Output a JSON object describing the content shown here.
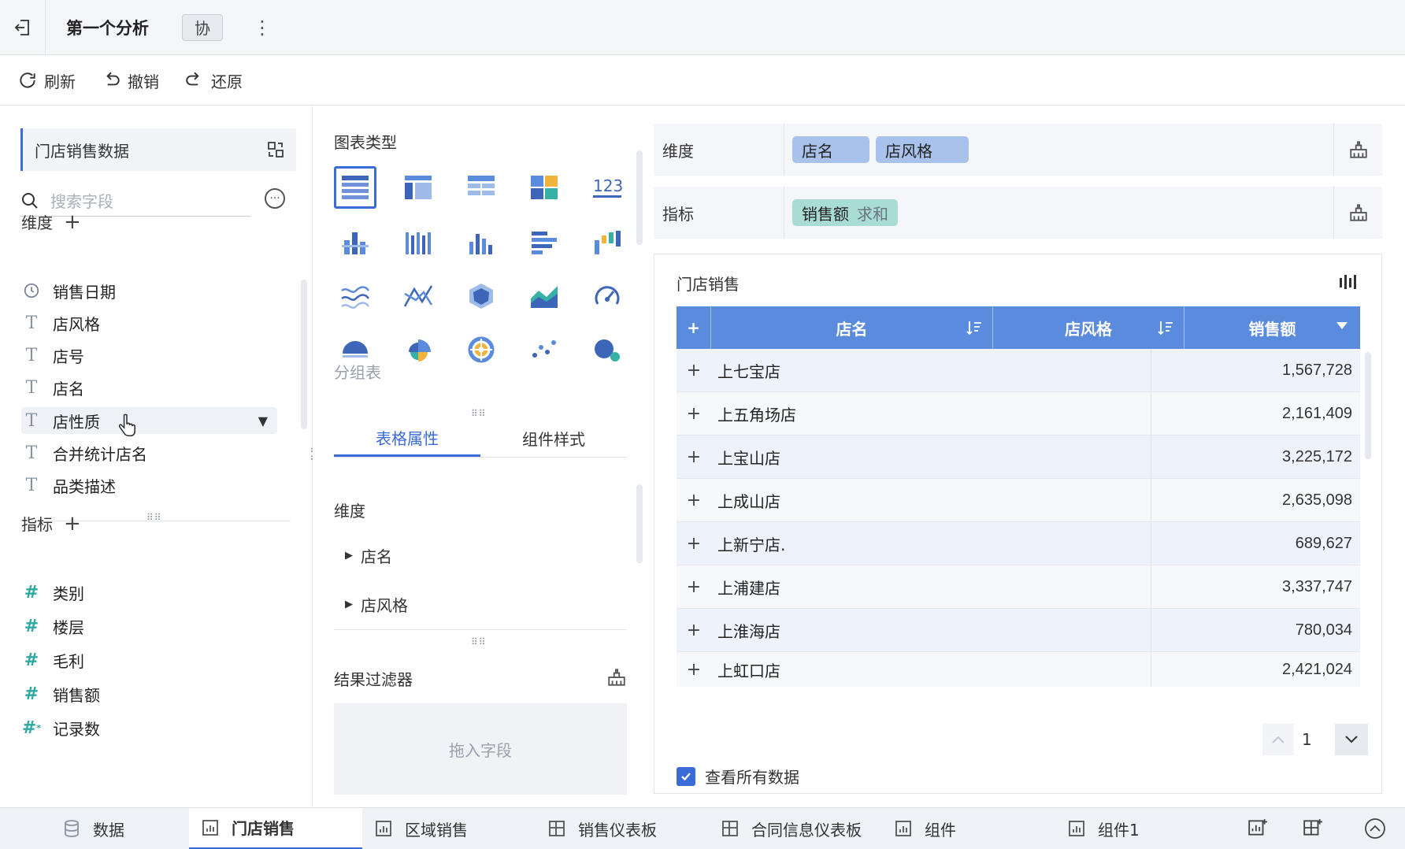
{
  "header": {
    "title": "第一个分析",
    "collab_label": "协",
    "more_label": "⋮"
  },
  "toolbar": {
    "refresh": "刷新",
    "undo": "撤销",
    "redo": "还原"
  },
  "left": {
    "dataset": "门店销售数据",
    "search_placeholder": "搜索字段",
    "dimensions_label": "维度",
    "dimensions": [
      {
        "label": "销售日期",
        "icon": "clock-icon"
      },
      {
        "label": "店风格",
        "icon": "text-type-icon"
      },
      {
        "label": "店号",
        "icon": "text-type-icon"
      },
      {
        "label": "店名",
        "icon": "text-type-icon"
      },
      {
        "label": "店性质",
        "icon": "text-type-icon"
      },
      {
        "label": "合并统计店名",
        "icon": "text-type-icon"
      },
      {
        "label": "品类描述",
        "icon": "text-type-icon"
      }
    ],
    "measures_label": "指标",
    "measures": [
      {
        "label": "类别",
        "icon": "number-type-icon"
      },
      {
        "label": "楼层",
        "icon": "number-type-icon"
      },
      {
        "label": "毛利",
        "icon": "number-type-icon"
      },
      {
        "label": "销售额",
        "icon": "number-type-icon"
      },
      {
        "label": "记录数",
        "icon": "computed-number-icon"
      }
    ]
  },
  "middle": {
    "chart_type_label": "图表类型",
    "selected_type_label": "分组表",
    "tabs": [
      "表格属性",
      "组件样式"
    ],
    "props_dimension_label": "维度",
    "props_dimensions": [
      "店名",
      "店风格"
    ],
    "result_filter_label": "结果过滤器",
    "drop_placeholder": "拖入字段"
  },
  "right": {
    "dimension_shelf_label": "维度",
    "dimension_pills": [
      "店名",
      "店风格"
    ],
    "measure_shelf_label": "指标",
    "measure_pill": "销售额",
    "measure_agg": "求和",
    "card_title": "门店销售",
    "table": {
      "headers": [
        "店名",
        "店风格",
        "销售额"
      ],
      "rows": [
        {
          "name": "上七宝店",
          "value": "1,567,728"
        },
        {
          "name": "上五角场店",
          "value": "2,161,409"
        },
        {
          "name": "上宝山店",
          "value": "3,225,172"
        },
        {
          "name": "上成山店",
          "value": "2,635,098"
        },
        {
          "name": "上新宁店.",
          "value": "689,627"
        },
        {
          "name": "上浦建店",
          "value": "3,337,747"
        },
        {
          "name": "上淮海店",
          "value": "780,034"
        },
        {
          "name": "上虹口店",
          "value": "2,421,024"
        }
      ]
    },
    "page_number": "1",
    "view_all_label": "查看所有数据"
  },
  "bottom_tabs": [
    "数据",
    "门店销售",
    "区域销售",
    "销售仪表板",
    "合同信息仪表板",
    "组件",
    "组件1"
  ],
  "colors": {
    "accent": "#3b6bd6",
    "table_header": "#5b8bdc",
    "dimension_pill": "#a8c2ec",
    "measure_pill": "#a8dcd5"
  }
}
